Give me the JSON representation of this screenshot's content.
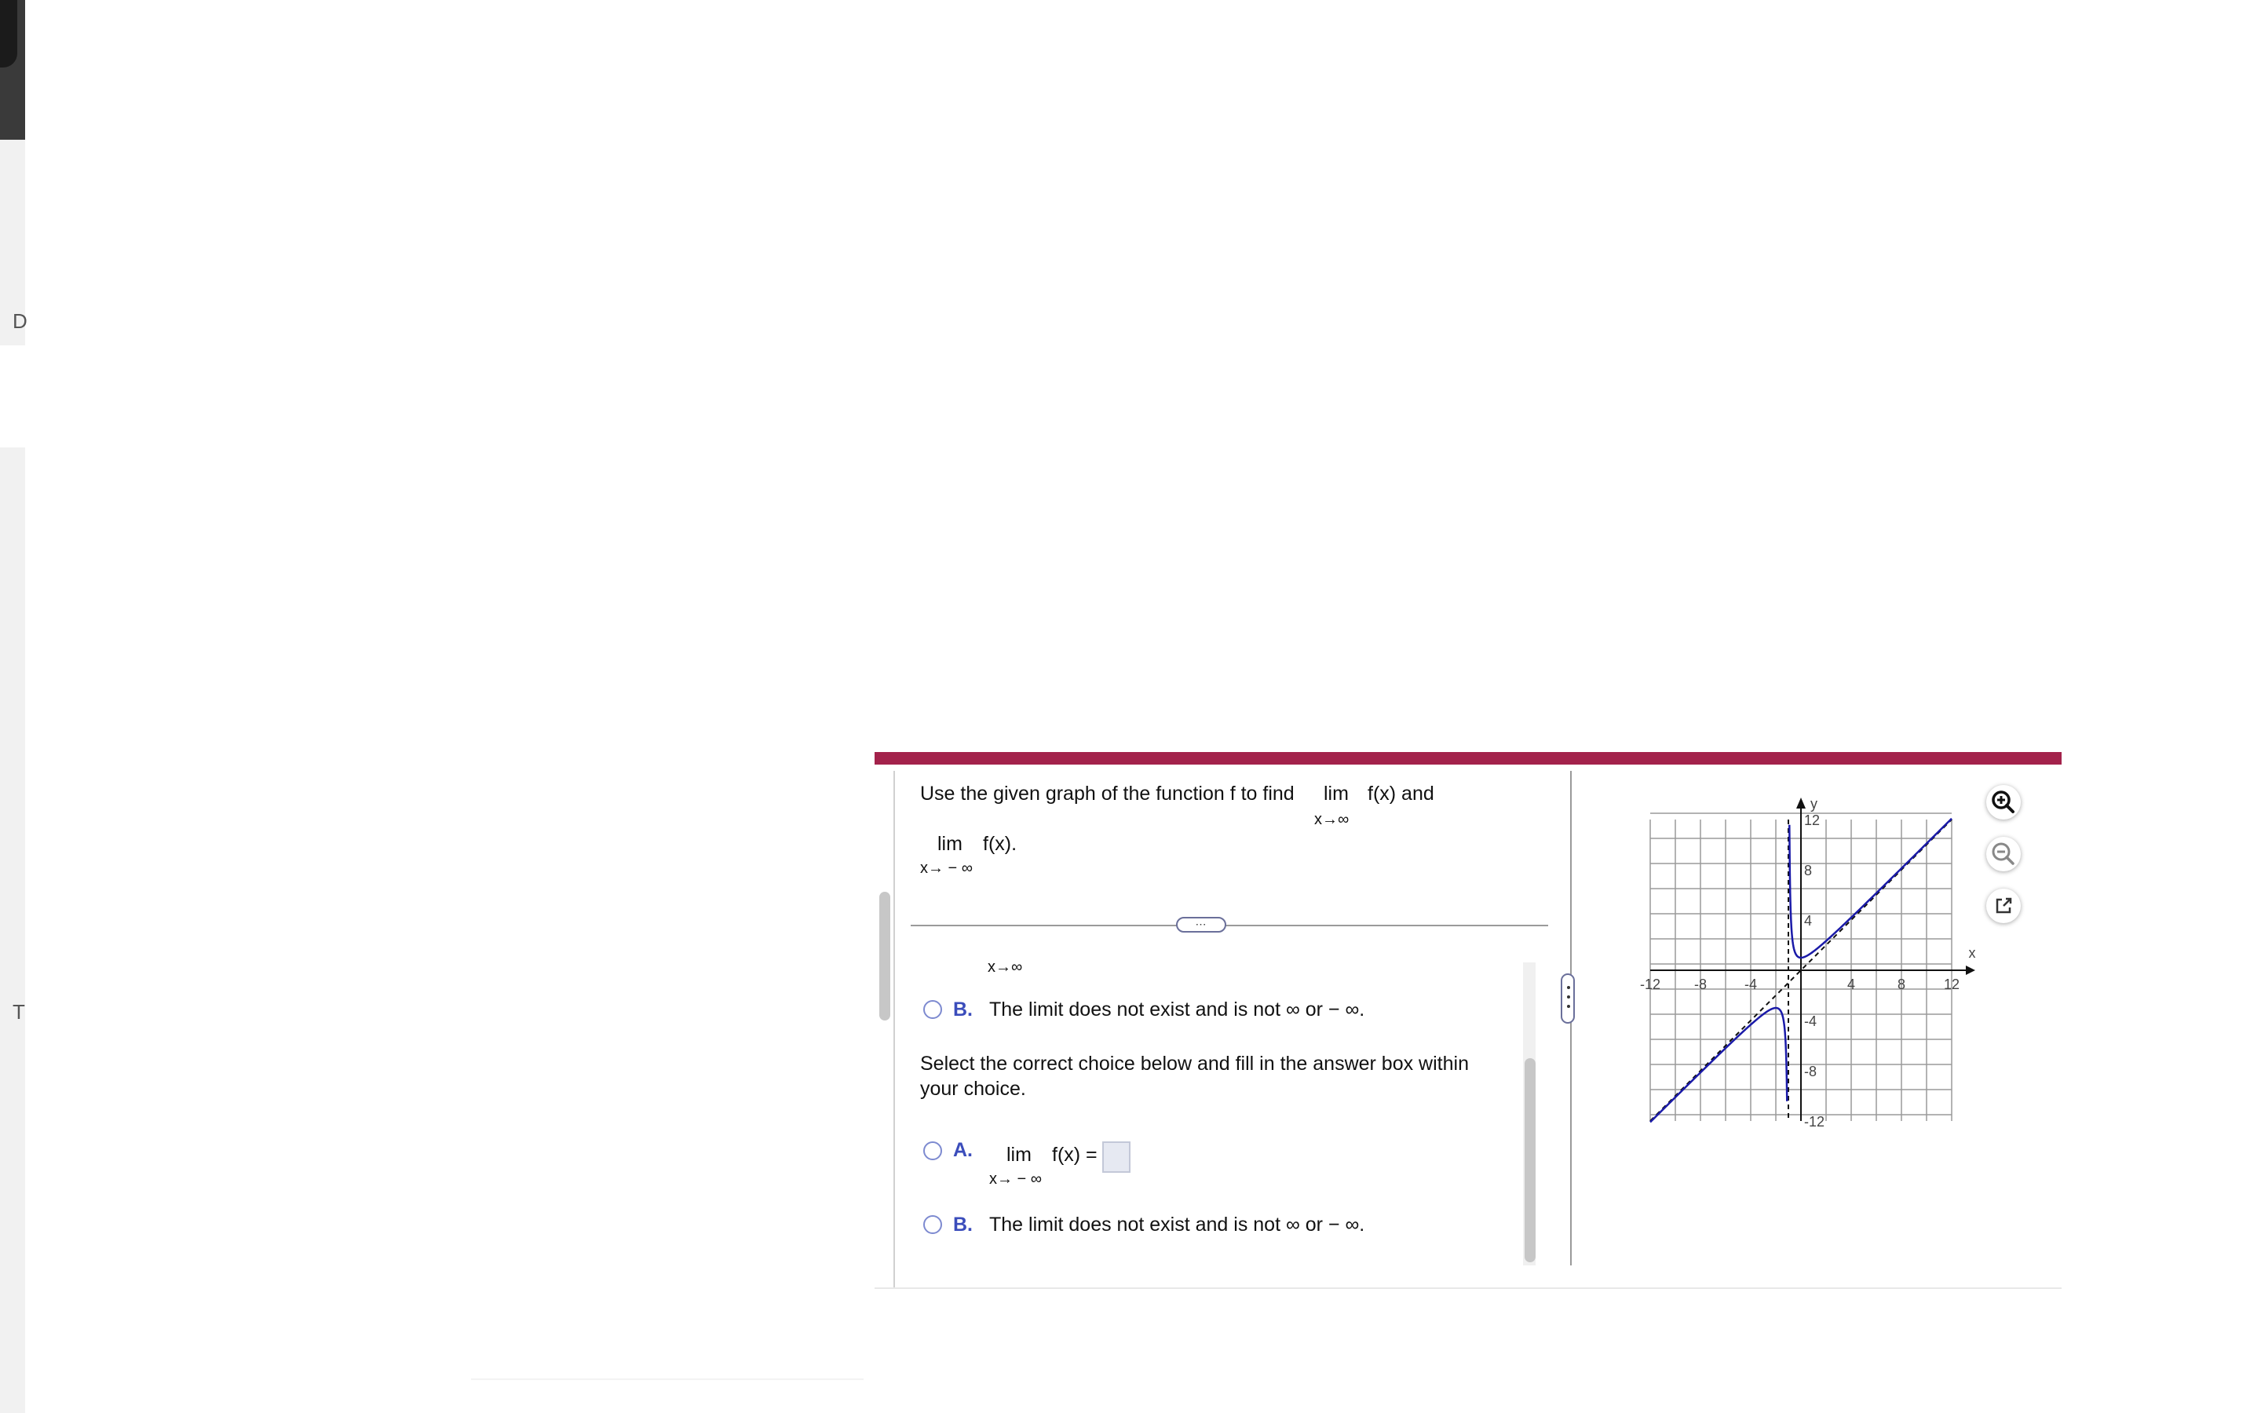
{
  "sidebar": {
    "letter_1": "D",
    "letter_2": "T"
  },
  "question": {
    "prompt_line1_part1": "Use the given graph of the function f to find",
    "prompt_lim": "lim",
    "prompt_fx": "f(x) and",
    "prompt_sub1": "x→∞",
    "prompt_line2_lim": "lim",
    "prompt_line2_fx": "f(x).",
    "prompt_sub2": "x→ − ∞",
    "collapse_dots": "⋯"
  },
  "part1": {
    "partial_sub": "x→∞",
    "option_b_letter": "B.",
    "option_b_text": "The limit does not exist and is not ∞ or  − ∞."
  },
  "part2": {
    "instruction_line1": "Select the correct choice below and fill in the answer box within",
    "instruction_line2": "your choice.",
    "option_a_letter": "A.",
    "option_a_lim": "lim",
    "option_a_fx": "f(x) =",
    "option_a_sub": "x→ − ∞",
    "option_a_value": "",
    "option_b_letter": "B.",
    "option_b_text": "The limit does not exist and is not ∞ or  − ∞."
  },
  "graph": {
    "y_axis_label": "y",
    "x_axis_label": "x",
    "x_tick_labels": [
      "-12",
      "-8",
      "-4",
      "4",
      "8",
      "12"
    ],
    "y_tick_labels": [
      "12",
      "8",
      "4",
      "-4",
      "-8",
      "-12"
    ],
    "curve_color": "#1a1aa8"
  },
  "toolbar": {
    "zoom_in": "zoom-in-icon",
    "zoom_out": "zoom-out-icon",
    "popout": "external-link-icon"
  },
  "colors": {
    "accent_bar": "#a3224b",
    "option_letter": "#3b4dbb"
  }
}
